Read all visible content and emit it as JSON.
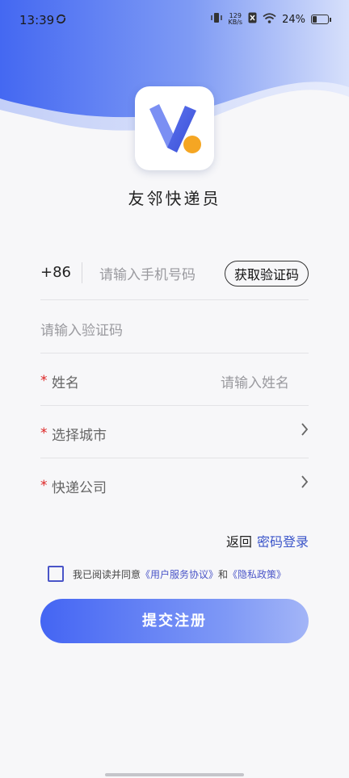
{
  "status": {
    "time": "13:39",
    "kbs_value": "129",
    "kbs_unit": "KB/s",
    "battery": "24%"
  },
  "app": {
    "name": "友邻快递员"
  },
  "form": {
    "country_code": "+86",
    "phone_placeholder": "请输入手机号码",
    "get_code_label": "获取验证码",
    "code_placeholder": "请输入验证码",
    "name_label": "姓名",
    "name_placeholder": "请输入姓名",
    "city_label": "选择城市",
    "company_label": "快递公司",
    "required_mark": "*"
  },
  "nav": {
    "back_label": "返回",
    "password_login_label": "密码登录"
  },
  "agreement": {
    "prefix": "我已阅读并同意",
    "user_agreement": "《用户服务协议》",
    "and": "和",
    "privacy_policy": "《隐私政策》"
  },
  "submit": {
    "label": "提交注册"
  },
  "colors": {
    "primary": "#4465f3",
    "link": "#4a55c8",
    "required": "#d22222",
    "logo_orange": "#f5a623"
  }
}
